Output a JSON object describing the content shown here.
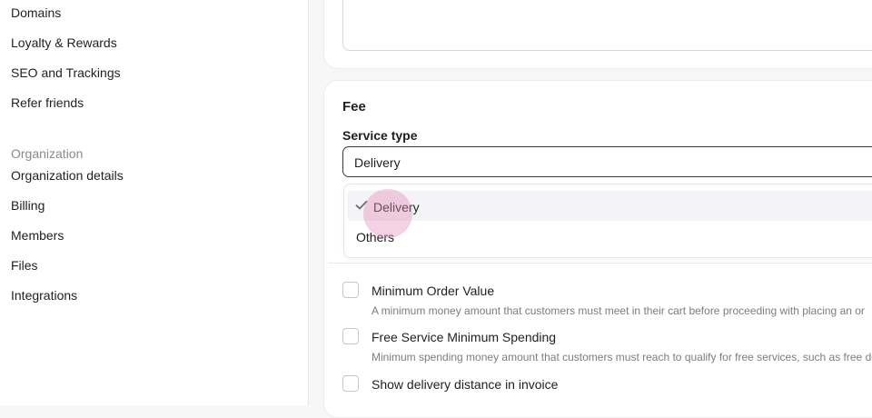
{
  "sidebar": {
    "items_top": [
      {
        "label": "Domains"
      },
      {
        "label": "Loyalty & Rewards"
      },
      {
        "label": "SEO and Trackings"
      },
      {
        "label": "Refer friends"
      }
    ],
    "section_label": "Organization",
    "items_org": [
      {
        "label": "Organization details"
      },
      {
        "label": "Billing"
      },
      {
        "label": "Members"
      },
      {
        "label": "Files"
      },
      {
        "label": "Integrations"
      }
    ]
  },
  "fee": {
    "title": "Fee",
    "service_type_label": "Service type",
    "service_type_value": "Delivery",
    "options": [
      {
        "label": "Delivery",
        "selected": true
      },
      {
        "label": "Others",
        "selected": false
      }
    ],
    "checkboxes": [
      {
        "label": "Minimum Order Value",
        "description": "A minimum money amount that customers must meet in their cart before proceeding with placing an or",
        "checked": false
      },
      {
        "label": "Free Service Minimum Spending",
        "description": "Minimum spending money amount that customers must reach to qualify for free services, such as free de",
        "checked": false
      },
      {
        "label": "Show delivery distance in invoice",
        "checked": false
      }
    ]
  },
  "icons": {
    "selected_option": "check-icon"
  },
  "colors": {
    "cursor_highlight": "#e68cbe",
    "section_label": "#8a8a8f"
  }
}
